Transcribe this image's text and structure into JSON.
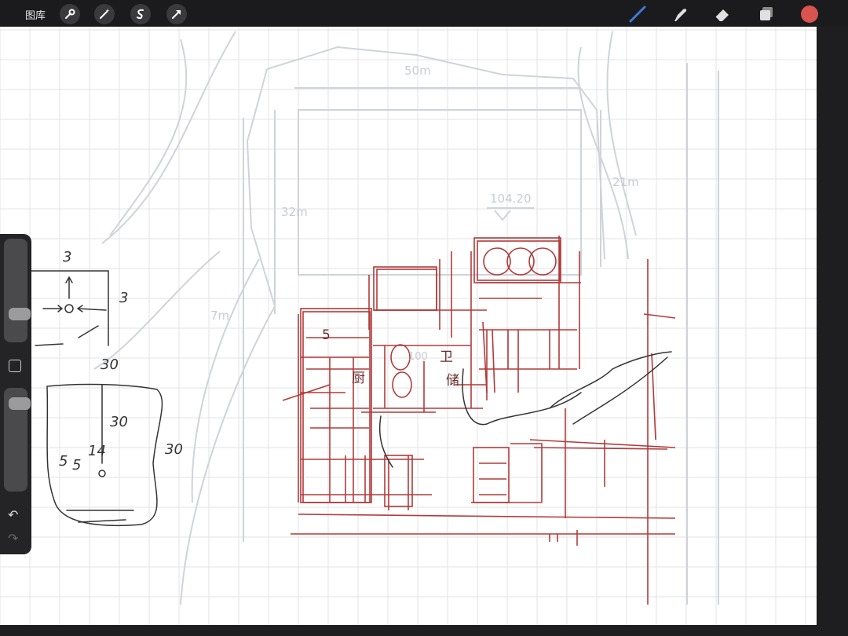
{
  "topbar": {
    "gallery_label": "图库",
    "left_tools": [
      "wrench-icon",
      "magic-wand-icon",
      "selection-icon",
      "transform-arrow-icon"
    ],
    "right_tools": [
      "brush-icon",
      "smudge-icon",
      "eraser-icon",
      "layers-icon"
    ],
    "brush_color": "#3b7bd9",
    "current_color": "#d9534f"
  },
  "sidebar": {
    "size_slider_level": 0.22,
    "opacity_slider_level": 0.93,
    "undo_icon": "undo-icon",
    "redo_icon": "redo-icon"
  },
  "canvas": {
    "background": "#ffffff",
    "grid_color": "#e3e3e6",
    "faint_labels": {
      "top_width": "50m",
      "left_height": "32m",
      "right_height": "21m",
      "elevation": "104.20",
      "side": "7m"
    },
    "red_sketch_color": "#b23a3a",
    "dark_sketch_color": "#333333",
    "left_notes": [
      "3",
      "3",
      "30",
      "30",
      "30",
      "5",
      "14",
      "5"
    ],
    "plan_notes": [
      "5",
      "厨",
      "卫",
      "储",
      "100"
    ]
  }
}
